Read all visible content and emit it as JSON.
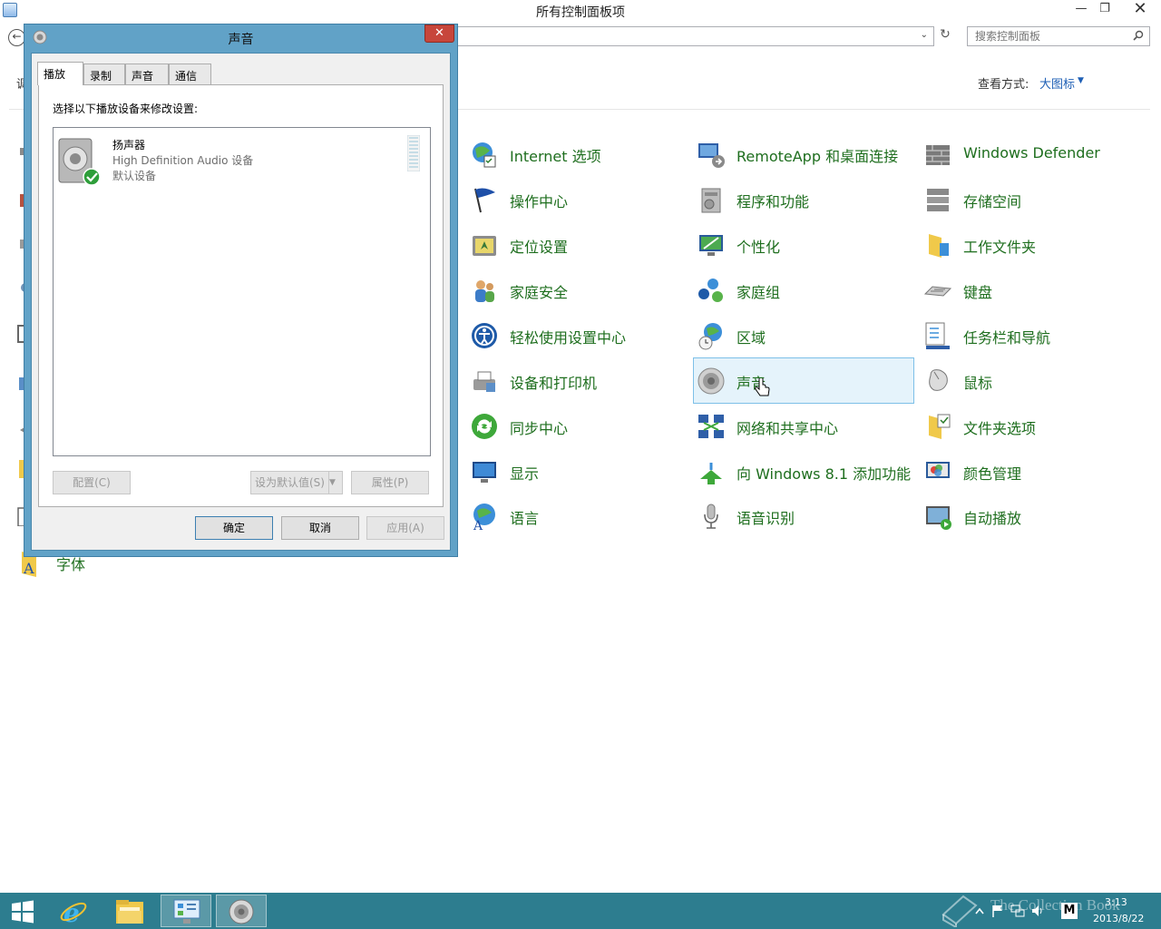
{
  "window": {
    "title": "所有控制面板项",
    "minimize_glyph": "—",
    "maximize_glyph": "❐",
    "close_glyph": "✕"
  },
  "nav": {
    "back_glyph": "←",
    "dropdown_glyph": "⌄",
    "refresh_glyph": "↻",
    "search_placeholder": "搜索控制面板"
  },
  "header": {
    "partial_left_label": "调",
    "view_by_label": "查看方式:",
    "view_by_value": "大图标",
    "view_by_arrow": "▼"
  },
  "items": [
    {
      "label": "Internet 选项",
      "icon": "internet-options-icon"
    },
    {
      "label": "RemoteApp 和桌面连接",
      "icon": "remoteapp-icon"
    },
    {
      "label": "Windows Defender",
      "icon": "windows-defender-icon"
    },
    {
      "label": "操作中心",
      "icon": "action-center-flag-icon"
    },
    {
      "label": "程序和功能",
      "icon": "programs-features-icon"
    },
    {
      "label": "存储空间",
      "icon": "storage-spaces-icon"
    },
    {
      "label": "定位设置",
      "icon": "location-settings-icon"
    },
    {
      "label": "个性化",
      "icon": "personalization-icon"
    },
    {
      "label": "工作文件夹",
      "icon": "work-folders-icon"
    },
    {
      "label": "家庭安全",
      "icon": "family-safety-icon"
    },
    {
      "label": "家庭组",
      "icon": "homegroup-icon"
    },
    {
      "label": "键盘",
      "icon": "keyboard-icon"
    },
    {
      "label": "轻松使用设置中心",
      "icon": "ease-of-access-icon"
    },
    {
      "label": "区域",
      "icon": "region-icon"
    },
    {
      "label": "任务栏和导航",
      "icon": "taskbar-navigation-icon"
    },
    {
      "label": "设备和打印机",
      "icon": "devices-printers-icon"
    },
    {
      "label": "声音",
      "icon": "sound-speaker-icon"
    },
    {
      "label": "鼠标",
      "icon": "mouse-icon"
    },
    {
      "label": "同步中心",
      "icon": "sync-center-icon"
    },
    {
      "label": "网络和共享中心",
      "icon": "network-sharing-icon"
    },
    {
      "label": "文件夹选项",
      "icon": "folder-options-icon"
    },
    {
      "label": "显示",
      "icon": "display-icon"
    },
    {
      "label": "向 Windows 8.1 添加功能",
      "icon": "add-features-icon"
    },
    {
      "label": "颜色管理",
      "icon": "color-management-icon"
    },
    {
      "label": "语言",
      "icon": "language-icon"
    },
    {
      "label": "语音识别",
      "icon": "speech-recognition-icon"
    },
    {
      "label": "自动播放",
      "icon": "autoplay-icon"
    },
    {
      "label": "字体",
      "icon": "fonts-icon"
    }
  ],
  "selected_item": "声音",
  "sound_dialog": {
    "title": "声音",
    "close_glyph": "✕",
    "tabs": [
      "播放",
      "录制",
      "声音",
      "通信"
    ],
    "active_tab": "播放",
    "instruction": "选择以下播放设备来修改设置:",
    "device": {
      "name": "扬声器",
      "description": "High Definition Audio 设备",
      "status": "默认设备"
    },
    "buttons": {
      "configure": "配置(C)",
      "set_default": "设为默认值(S)",
      "set_default_arrow": "▼",
      "properties": "属性(P)",
      "ok": "确定",
      "cancel": "取消",
      "apply": "应用(A)"
    }
  },
  "taskbar": {
    "time": "3:13",
    "date": "2013/8/22",
    "watermark": "The Collection Book",
    "ime_label": "M"
  },
  "colors": {
    "link_green": "#1e6e1e",
    "accent_blue": "#1e5fb5",
    "dialog_frame": "#61a2c7",
    "close_red": "#c7463b",
    "taskbar": "#2d7d8f",
    "selection": "#e5f3fb"
  }
}
